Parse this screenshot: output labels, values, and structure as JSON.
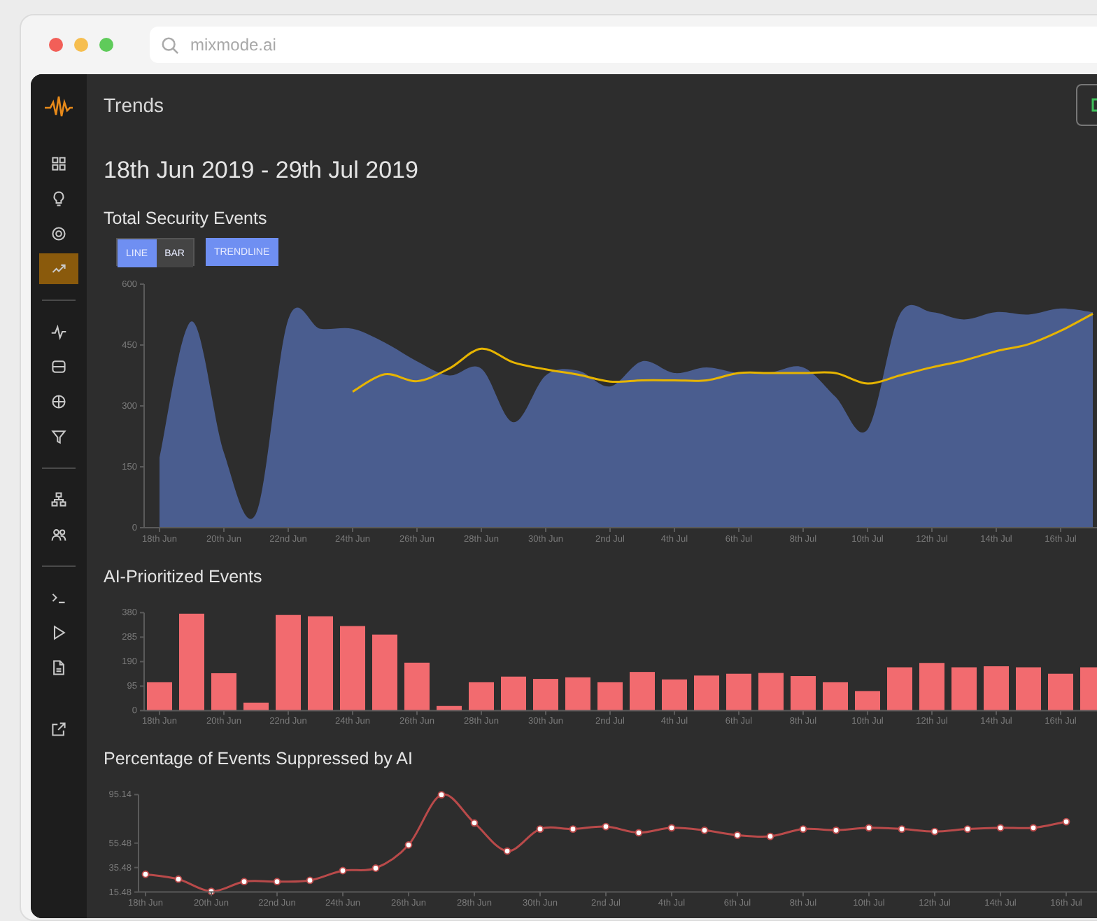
{
  "browser": {
    "url": "mixmode.ai"
  },
  "sidebar": {
    "groups": [
      {
        "items": [
          {
            "selected": false
          },
          {
            "selected": false
          },
          {
            "selected": false
          },
          {
            "selected": true
          }
        ]
      },
      {
        "items": [
          {
            "selected": false
          },
          {
            "selected": false
          },
          {
            "selected": false
          },
          {
            "selected": false
          }
        ]
      },
      {
        "items": [
          {
            "selected": false
          },
          {
            "selected": false
          }
        ]
      },
      {
        "items": [
          {
            "selected": false
          },
          {
            "selected": false
          },
          {
            "selected": false
          }
        ]
      }
    ],
    "footer": [
      {
        "selected": false
      }
    ]
  },
  "header": {
    "title": "Trends"
  },
  "date_range": "18th Jun 2019 - 29th Jul 2019",
  "sections": [
    {
      "title": "Total Security Events",
      "view_toggle": [
        {
          "label": "LINE",
          "selected": true
        },
        {
          "label": "BAR",
          "selected": false
        }
      ],
      "trendline_toggle": {
        "label": "TRENDLINE",
        "on": true
      },
      "chart_data": {
        "type": "area",
        "categories": [
          "18th Jun",
          null,
          "20th Jun",
          null,
          "22nd Jun",
          null,
          "24th Jun",
          null,
          "26th Jun",
          null,
          "28th Jun",
          null,
          "30th Jun",
          null,
          "2nd Jul",
          null,
          "4th Jul",
          null,
          "6th Jul",
          null,
          "8th Jul",
          null,
          "10th Jul",
          null,
          "12th Jul",
          null,
          "14th Jul",
          null,
          "16th Jul",
          null
        ],
        "series": [
          {
            "type": "area",
            "color": "#4a5d8f",
            "values": [
              173,
              508,
              185,
              35,
              513,
              490,
              490,
              456,
              410,
              375,
              392,
              260,
              375,
              387,
              348,
              410,
              381,
              395,
              381,
              383,
              395,
              323,
              242,
              525,
              531,
              513,
              531,
              525,
              540,
              531
            ]
          },
          {
            "type": "line",
            "color": "#e6b400",
            "values": [
              null,
              null,
              null,
              null,
              null,
              null,
              335,
              378,
              361,
              392,
              441,
              407,
              390,
              377,
              360,
              363,
              363,
              363,
              381,
              381,
              381,
              381,
              355,
              375,
              395,
              412,
              435,
              452,
              485,
              527
            ]
          }
        ],
        "ylim": [
          0,
          600
        ],
        "yticks": [
          0,
          150,
          300,
          450,
          600
        ]
      }
    },
    {
      "title": "AI-Prioritized Events",
      "chart_data": {
        "type": "bar",
        "categories": [
          "18th Jun",
          null,
          "20th Jun",
          null,
          "22nd Jun",
          null,
          "24th Jun",
          null,
          "26th Jun",
          null,
          "28th Jun",
          null,
          "30th Jun",
          null,
          "2nd Jul",
          null,
          "4th Jul",
          null,
          "6th Jul",
          null,
          "8th Jul",
          null,
          "10th Jul",
          null,
          "12th Jul",
          null,
          "14th Jul",
          null,
          "16th Jul",
          null
        ],
        "series": [
          {
            "type": "bar",
            "color": "#f26b6f",
            "values": [
              110,
              376,
              145,
              31,
              371,
              366,
              328,
              295,
              186,
              18,
              110,
              132,
              123,
              129,
              110,
              150,
              121,
              136,
              143,
              146,
              134,
              110,
              76,
              168,
              185,
              168,
              172,
              168,
              143,
              168
            ]
          }
        ],
        "ylim": [
          0,
          380
        ],
        "yticks": [
          0,
          95,
          190,
          285,
          380
        ]
      }
    },
    {
      "title": "Percentage of Events Suppressed by AI",
      "chart_data": {
        "type": "line",
        "categories": [
          "18th Jun",
          null,
          "20th Jun",
          null,
          "22nd Jun",
          null,
          "24th Jun",
          null,
          "26th Jun",
          null,
          "28th Jun",
          null,
          "30th Jun",
          null,
          "2nd Jul",
          null,
          "4th Jul",
          null,
          "6th Jul",
          null,
          "8th Jul",
          null,
          "10th Jul",
          null,
          "12th Jul",
          null,
          "14th Jul",
          null,
          "16th Jul"
        ],
        "series": [
          {
            "type": "line",
            "marker": "circle",
            "color": "#b94a4a",
            "values": [
              30,
              26,
              16,
              24,
              24,
              25,
              33,
              35,
              54,
              95,
              72,
              49,
              67,
              67,
              69,
              64,
              68,
              66,
              62,
              61,
              67,
              66,
              68,
              67,
              65,
              67,
              68,
              68,
              73
            ]
          }
        ],
        "ylim": [
          15.48,
          95.14
        ],
        "yticks": [
          15.48,
          35.48,
          55.48,
          95.14
        ]
      }
    }
  ]
}
